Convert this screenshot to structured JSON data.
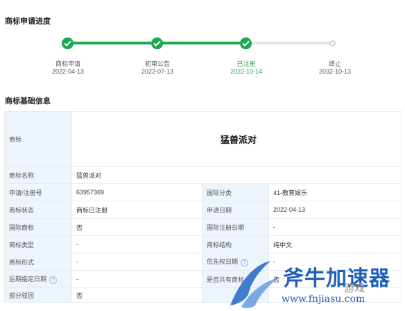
{
  "progress": {
    "title": "商标申请进度",
    "steps": [
      {
        "label": "商标申请",
        "date": "2022-04-13",
        "status": "done"
      },
      {
        "label": "初审公告",
        "date": "2022-07-13",
        "status": "done"
      },
      {
        "label": "已注册",
        "date": "2022-10-14",
        "status": "current"
      },
      {
        "label": "终止",
        "date": "2032-10-13",
        "status": "pending"
      }
    ]
  },
  "info": {
    "title": "商标基础信息",
    "logo_label": "商标",
    "logo_text": "猛兽派对",
    "name_label": "商标名称",
    "name_value": "猛兽派对",
    "rows": [
      {
        "l1": "申请/注册号",
        "v1": "63957369",
        "l2": "国际分类",
        "v2": "41-教育娱乐"
      },
      {
        "l1": "商标状态",
        "v1": "商标已注册",
        "l2": "申请日期",
        "v2": "2022-04-13"
      },
      {
        "l1": "国际商标",
        "v1": "否",
        "l2": "国际注册日期",
        "v2": "-"
      },
      {
        "l1": "商标类型",
        "v1": "-",
        "l2": "商标结构",
        "v2": "纯中文"
      },
      {
        "l1": "商标形式",
        "v1": "-",
        "l2": "优先权日期",
        "v2": "-"
      },
      {
        "l1": "后期指定日期",
        "v1": "-",
        "l2": "是否共有商标",
        "v2": "否"
      }
    ],
    "partial_label": "部分驳回",
    "partial_value": "否"
  },
  "watermark": {
    "brand": "斧牛加速器",
    "url": "www.fnjiasu.com",
    "extra": "游戏"
  },
  "colors": {
    "accent": "#1ea84f",
    "label_bg": "#eef4fb",
    "watermark": "#1f5fb8"
  }
}
